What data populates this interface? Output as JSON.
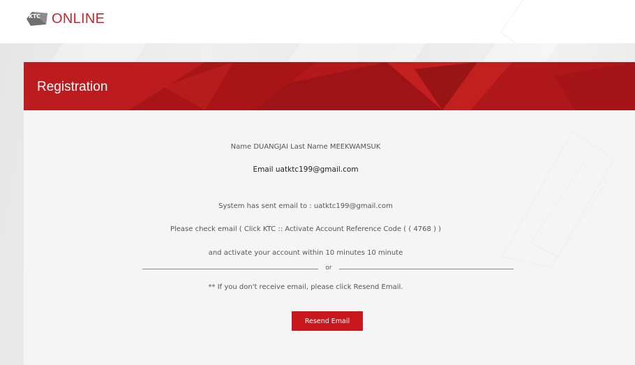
{
  "header": {
    "logo_mark": "KTC",
    "logo_text": "ONLINE"
  },
  "banner": {
    "title": "Registration"
  },
  "content": {
    "name_line": "Name DUANGJAI Last Name MEEKWAMSUK",
    "email_line": "Email uatktc199@gmail.com",
    "sent_line": "System has sent email to : uatktc199@gmail.com",
    "check_line": "Please check email ( Click KTC :: Activate Account Reference Code ( ( 4768 ) )",
    "activate_line": "and activate your account within 10 minutes 10 minute",
    "or_label": "or",
    "resend_hint": "** If you don't receive email, please click Resend Email.",
    "resend_button": "Resend Email"
  },
  "colors": {
    "brand_red": "#c8171d",
    "banner_red": "#b8191c",
    "page_bg": "#ececec",
    "card_bg": "#f5f5f5"
  },
  "icons": {
    "logo": "ktc-logo-icon"
  }
}
